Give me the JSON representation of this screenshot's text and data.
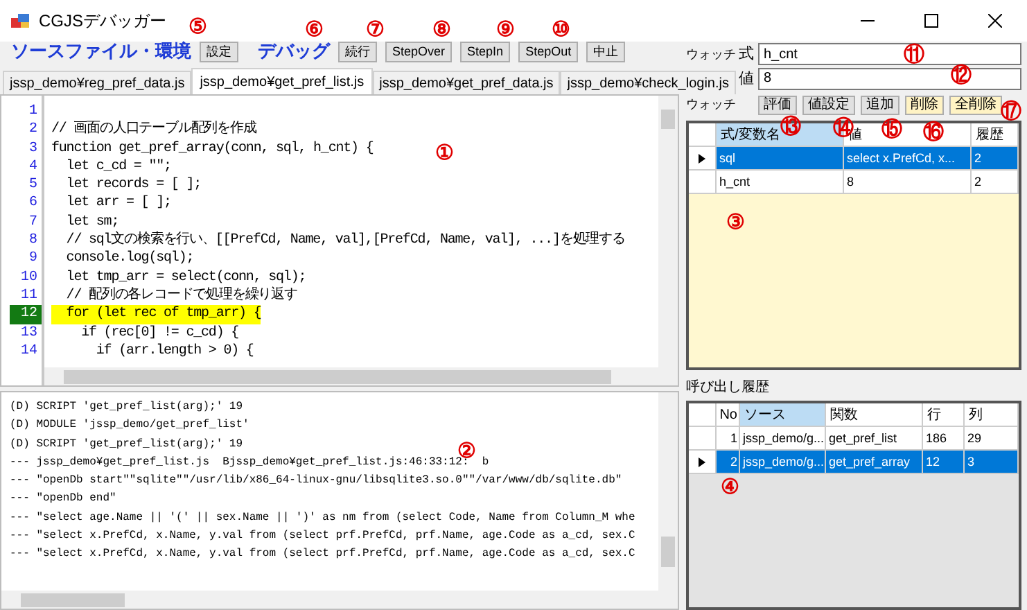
{
  "window": {
    "title": "CGJSデバッガー"
  },
  "toolbar": [
    {
      "kind": "label",
      "text": "ソースファイル・環境"
    },
    {
      "kind": "button",
      "text": "設定"
    },
    {
      "kind": "label",
      "text": "デバッグ"
    },
    {
      "kind": "button",
      "text": "続行"
    },
    {
      "kind": "button",
      "text": "StepOver"
    },
    {
      "kind": "button",
      "text": "StepIn"
    },
    {
      "kind": "button",
      "text": "StepOut"
    },
    {
      "kind": "button",
      "text": "中止"
    }
  ],
  "tabs": [
    {
      "label": "jssp_demo¥reg_pref_data.js",
      "selected": false
    },
    {
      "label": "jssp_demo¥get_pref_list.js",
      "selected": true
    },
    {
      "label": "jssp_demo¥get_pref_data.js",
      "selected": false
    },
    {
      "label": "jssp_demo¥check_login.js",
      "selected": false
    }
  ],
  "editor": {
    "lines": [
      {
        "number": "1",
        "current": false
      },
      {
        "number": "2",
        "code": "// 画面の人口テーブル配列を作成",
        "current": false
      },
      {
        "number": "3",
        "code": "function get_pref_array(conn, sql, h_cnt) {",
        "current": false
      },
      {
        "number": "4",
        "code": "  let c_cd = \"\";",
        "current": false
      },
      {
        "number": "5",
        "code": "  let records = [ ];",
        "current": false
      },
      {
        "number": "6",
        "code": "  let arr = [ ];",
        "current": false
      },
      {
        "number": "7",
        "code": "  let sm;",
        "current": false
      },
      {
        "number": "8",
        "code": "  // sql文の検索を行い、[[PrefCd, Name, val],[PrefCd, Name, val], ...]を処理する",
        "current": false
      },
      {
        "number": "9",
        "code": "  console.log(sql);",
        "current": false
      },
      {
        "number": "10",
        "code": "  let tmp_arr = select(conn, sql);",
        "current": false
      },
      {
        "number": "11",
        "code": "  // 配列の各レコードで処理を繰り返す",
        "current": false
      },
      {
        "number": "12",
        "code": "  for (let rec of tmp_arr) {",
        "current": true
      },
      {
        "number": "13",
        "code": "    if (rec[0] != c_cd) {",
        "current": false
      },
      {
        "number": "14",
        "code": "      if (arr.length > 0) {",
        "current": false
      }
    ]
  },
  "output": {
    "lines": [
      "(D) SCRIPT 'get_pref_list(arg);' 19",
      "(D) MODULE 'jssp_demo/get_pref_list'",
      "(D) SCRIPT 'get_pref_list(arg);' 19",
      "--- jssp_demo¥get_pref_list.js  Bjssp_demo¥get_pref_list.js:46:33:12:  b",
      "--- \"openDb start\"\"sqlite\"\"/usr/lib/x86_64-linux-gnu/libsqlite3.so.0\"\"/var/www/db/sqlite.db\"",
      "--- \"openDb end\"",
      "--- \"select age.Name || '(' || sex.Name || ')' as nm from (select Code, Name from Column_M whe",
      "--- \"select x.PrefCd, x.Name, y.val from (select prf.PrefCd, prf.Name, age.Code as a_cd, sex.C",
      "--- \"select x.PrefCd, x.Name, y.val from (select prf.PrefCd, prf.Name, age.Code as a_cd, sex.C"
    ]
  },
  "watch": {
    "expression_label": "ウォッチ",
    "expression_sublabel": "式",
    "expression": "h_cnt",
    "value_label": "値",
    "value": "8",
    "list_label": "ウォッチ",
    "buttons": [
      {
        "label": "評価",
        "highlighted": false
      },
      {
        "label": "値設定",
        "highlighted": false
      },
      {
        "label": "追加",
        "highlighted": false
      },
      {
        "label": "削除",
        "highlighted": true
      },
      {
        "label": "全削除",
        "highlighted": true
      }
    ],
    "columns": [
      {
        "label": "式/変数名",
        "selected": true
      },
      {
        "label": "値",
        "selected": false
      },
      {
        "label": "履歴",
        "selected": false
      }
    ],
    "rows": [
      {
        "cells": [
          "sql",
          "select x.PrefCd, x...",
          "2"
        ],
        "selected": true
      },
      {
        "cells": [
          "h_cnt",
          "8",
          "2"
        ],
        "selected": false
      }
    ]
  },
  "call_stack": {
    "title": "呼び出し履歴",
    "columns": [
      {
        "label": "No",
        "selected": false
      },
      {
        "label": "ソース",
        "selected": true
      },
      {
        "label": "関数",
        "selected": false
      },
      {
        "label": "行",
        "selected": false
      },
      {
        "label": "列",
        "selected": false
      }
    ],
    "rows": [
      {
        "cells": [
          "1",
          "jssp_demo/g...",
          "get_pref_list",
          "186",
          "29"
        ],
        "selected": false
      },
      {
        "cells": [
          "2",
          "jssp_demo/g...",
          "get_pref_array",
          "12",
          "3"
        ],
        "selected": true
      }
    ]
  },
  "annotations": [
    "①",
    "②",
    "③",
    "④",
    "⑤",
    "⑥",
    "⑦",
    "⑧",
    "⑨",
    "⑩",
    "⑪",
    "⑫",
    "⑬",
    "⑭",
    "⑮",
    "⑯",
    "⑰"
  ]
}
